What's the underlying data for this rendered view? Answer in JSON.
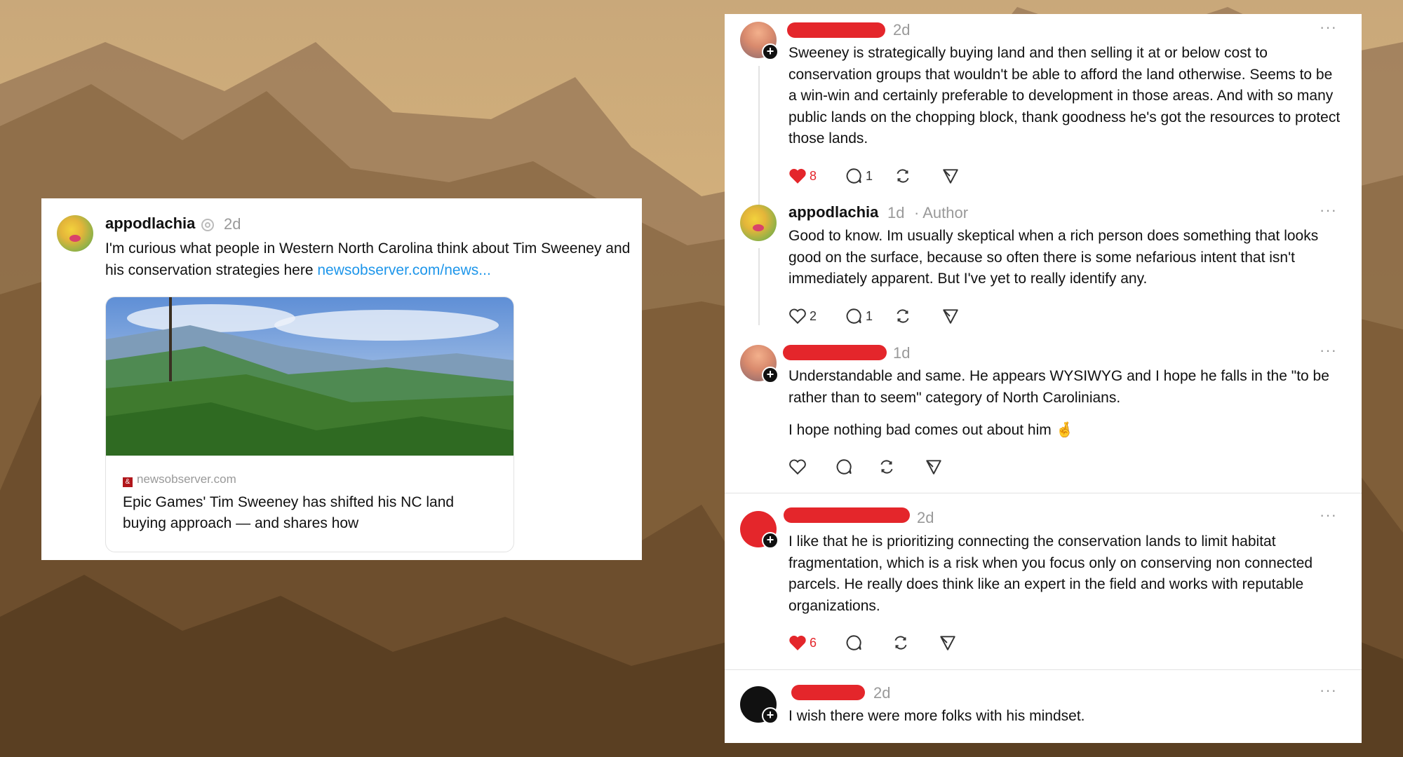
{
  "left_post": {
    "username": "appodlachia",
    "time": "2d",
    "text": "I'm curious what people in Western North Carolina think about Tim Sweeney and his conservation strategies here",
    "link_text": "newsobserver.com/news...",
    "preview": {
      "source": "newsobserver.com",
      "source_icon": "&",
      "title": "Epic Games' Tim Sweeney has shifted his NC land buying approach — and shares how"
    }
  },
  "comments": [
    {
      "time": "2d",
      "text": "Sweeney is strategically buying land and then selling it at or below cost to conservation groups that wouldn't be able to afford the land otherwise. Seems to be a win-win and certainly preferable to development in those areas. And with so many public lands on the chopping block, thank goodness he's got the resources to protect those lands.",
      "likes": "8",
      "replies": "1",
      "liked": true
    },
    {
      "username": "appodlachia",
      "time": "1d",
      "author_tag": "· Author",
      "text": "Good to know. Im usually skeptical when a rich person does something that looks good on the surface, because so often there is some nefarious intent that isn't immediately apparent. But I've yet to really identify any.",
      "likes": "2",
      "replies": "1",
      "liked": false
    },
    {
      "time": "1d",
      "text": "Understandable and same. He appears WYSIWYG and I hope he falls in the \"to be rather than to seem\" category of North Carolinians.",
      "text2": "I hope nothing bad comes out about him 🤞",
      "likes": "",
      "replies": "",
      "liked": false
    },
    {
      "time": "2d",
      "text": "I like that he is prioritizing connecting the conservation lands to limit habitat fragmentation, which is a risk when you focus only on conserving non connected parcels. He really does think like an expert in the field and works with reputable organizations.",
      "likes": "6",
      "replies": "",
      "liked": true
    },
    {
      "time": "2d",
      "text": "I wish there were more folks with his mindset."
    }
  ],
  "more_label": "···",
  "colors": {
    "like_red": "#e4262b",
    "link_blue": "#1e96ea",
    "redaction": "#e4262b"
  }
}
